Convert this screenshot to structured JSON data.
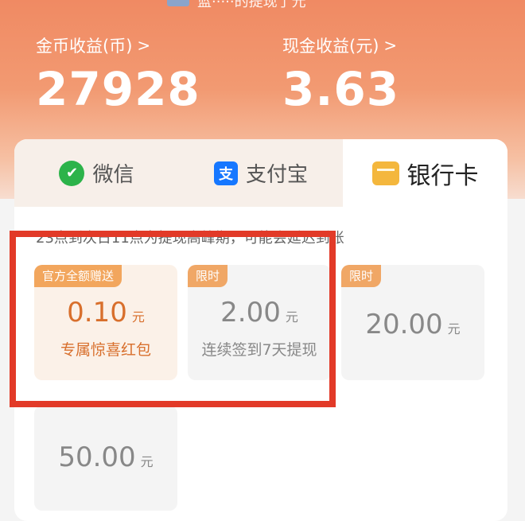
{
  "banner": {
    "text": "蓝·····的提现了元"
  },
  "stats": {
    "coin": {
      "label": "金币收益(币)",
      "value": "27928"
    },
    "cash": {
      "label": "现金收益(元)",
      "value": "3.63"
    },
    "chevron": ">"
  },
  "tabs": [
    {
      "label": "微信",
      "icon": "wechat-icon",
      "glyph": "✔"
    },
    {
      "label": "支付宝",
      "icon": "alipay-icon",
      "glyph": "支"
    },
    {
      "label": "银行卡",
      "icon": "bank-card-icon",
      "active": true
    }
  ],
  "notice": "23点到次日11点为提现高峰期，可能会延迟到账",
  "options": [
    {
      "badge": "官方全额赠送",
      "amount": "0.10",
      "unit": "元",
      "subtitle": "专属惊喜红包",
      "selected": true
    },
    {
      "badge": "限时",
      "amount": "2.00",
      "unit": "元",
      "subtitle": "连续签到7天提现"
    },
    {
      "badge": "限时",
      "amount": "20.00",
      "unit": "元"
    },
    {
      "amount": "50.00",
      "unit": "元"
    }
  ],
  "colors": {
    "accent": "#d86f2c",
    "highlight": "#e23a28",
    "header": "#f08a63"
  }
}
